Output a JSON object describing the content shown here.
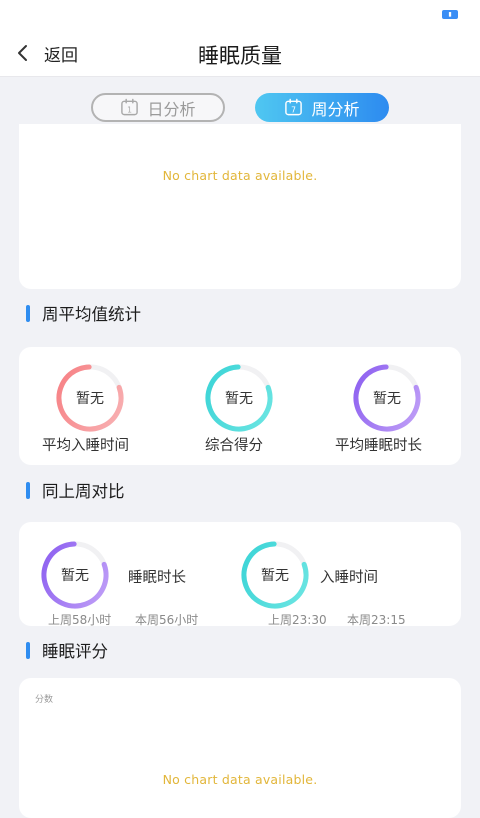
{
  "nav": {
    "back_label": "返回",
    "title": "睡眠质量"
  },
  "tabs": [
    {
      "label": "日分析",
      "icon": "calendar-day-icon",
      "icon_text": "1",
      "active": false
    },
    {
      "label": "周分析",
      "icon": "calendar-week-icon",
      "icon_text": "7",
      "active": true
    }
  ],
  "top_chart": {
    "empty_text": "No chart data available."
  },
  "weekly_avg": {
    "heading": "周平均值统计",
    "metrics": [
      {
        "value": "暂无",
        "label": "平均入睡时间",
        "color_start": "#f77e82",
        "color_end": "#f8b3b5"
      },
      {
        "value": "暂无",
        "label": "综合得分",
        "color_start": "#39d3d6",
        "color_end": "#6ee6e3"
      },
      {
        "value": "暂无",
        "label": "平均睡眠时长",
        "color_start": "#8a5cf0",
        "color_end": "#c2a2f7"
      }
    ]
  },
  "comparison": {
    "heading": "同上周对比",
    "items": [
      {
        "value": "暂无",
        "label": "睡眠时长",
        "last_week": "上周58小时",
        "this_week": "本周56小时",
        "color_start": "#8a5cf0",
        "color_end": "#c2a2f7"
      },
      {
        "value": "暂无",
        "label": "入睡时间",
        "last_week": "上周23:30",
        "this_week": "本周23:15",
        "color_start": "#39d3d6",
        "color_end": "#6ee6e3"
      }
    ]
  },
  "score": {
    "heading": "睡眠评分",
    "axis_label": "分数",
    "empty_text": "No chart data available."
  },
  "colors": {
    "accent": "#2f8df0",
    "empty_text": "#e2b63a",
    "background": "#f1f2f6"
  }
}
